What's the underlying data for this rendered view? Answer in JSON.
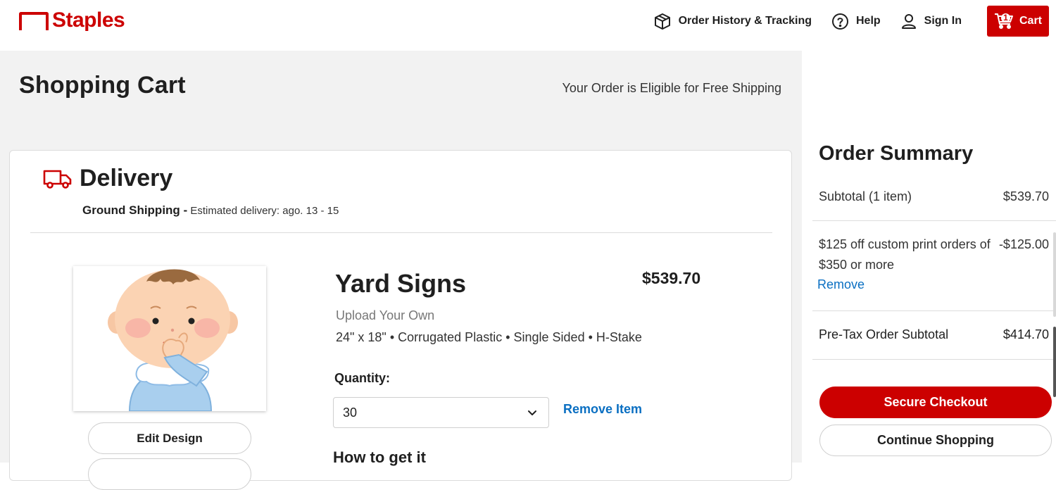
{
  "header": {
    "logo_text": "Staples",
    "nav": {
      "order_history": "Order History & Tracking",
      "help": "Help",
      "sign_in": "Sign In",
      "cart": "Cart",
      "cart_count": "1"
    }
  },
  "main": {
    "title": "Shopping Cart",
    "free_shipping": "Your Order is Eligible for Free Shipping",
    "delivery": {
      "title": "Delivery",
      "method": "Ground Shipping -",
      "estimate": "Estimated delivery: ago. 13 - 15"
    },
    "item": {
      "name": "Yard Signs",
      "price": "$539.70",
      "subtitle": "Upload Your Own",
      "specs": "24\" x 18\" • Corrugated Plastic • Single Sided • H-Stake",
      "quantity_label": "Quantity:",
      "quantity_value": "30",
      "remove_label": "Remove Item",
      "edit_label": "Edit Design"
    },
    "how_to_get": "How to get it"
  },
  "summary": {
    "title": "Order Summary",
    "subtotal_label": "Subtotal (1 item)",
    "subtotal_value": "$539.70",
    "promo_label": "$125 off custom print orders of $350 or more",
    "promo_value": "-$125.00",
    "remove_label": "Remove",
    "pretax_label": "Pre-Tax Order Subtotal",
    "pretax_value": "$414.70",
    "checkout_label": "Secure Checkout",
    "continue_label": "Continue Shopping"
  },
  "colors": {
    "brand_red": "#cc0000",
    "link_blue": "#0a6fc2",
    "page_grey": "#f2f2f2"
  },
  "icons": [
    "box-icon",
    "help-circle-icon",
    "user-icon",
    "cart-icon",
    "truck-icon",
    "chevron-down-icon"
  ]
}
